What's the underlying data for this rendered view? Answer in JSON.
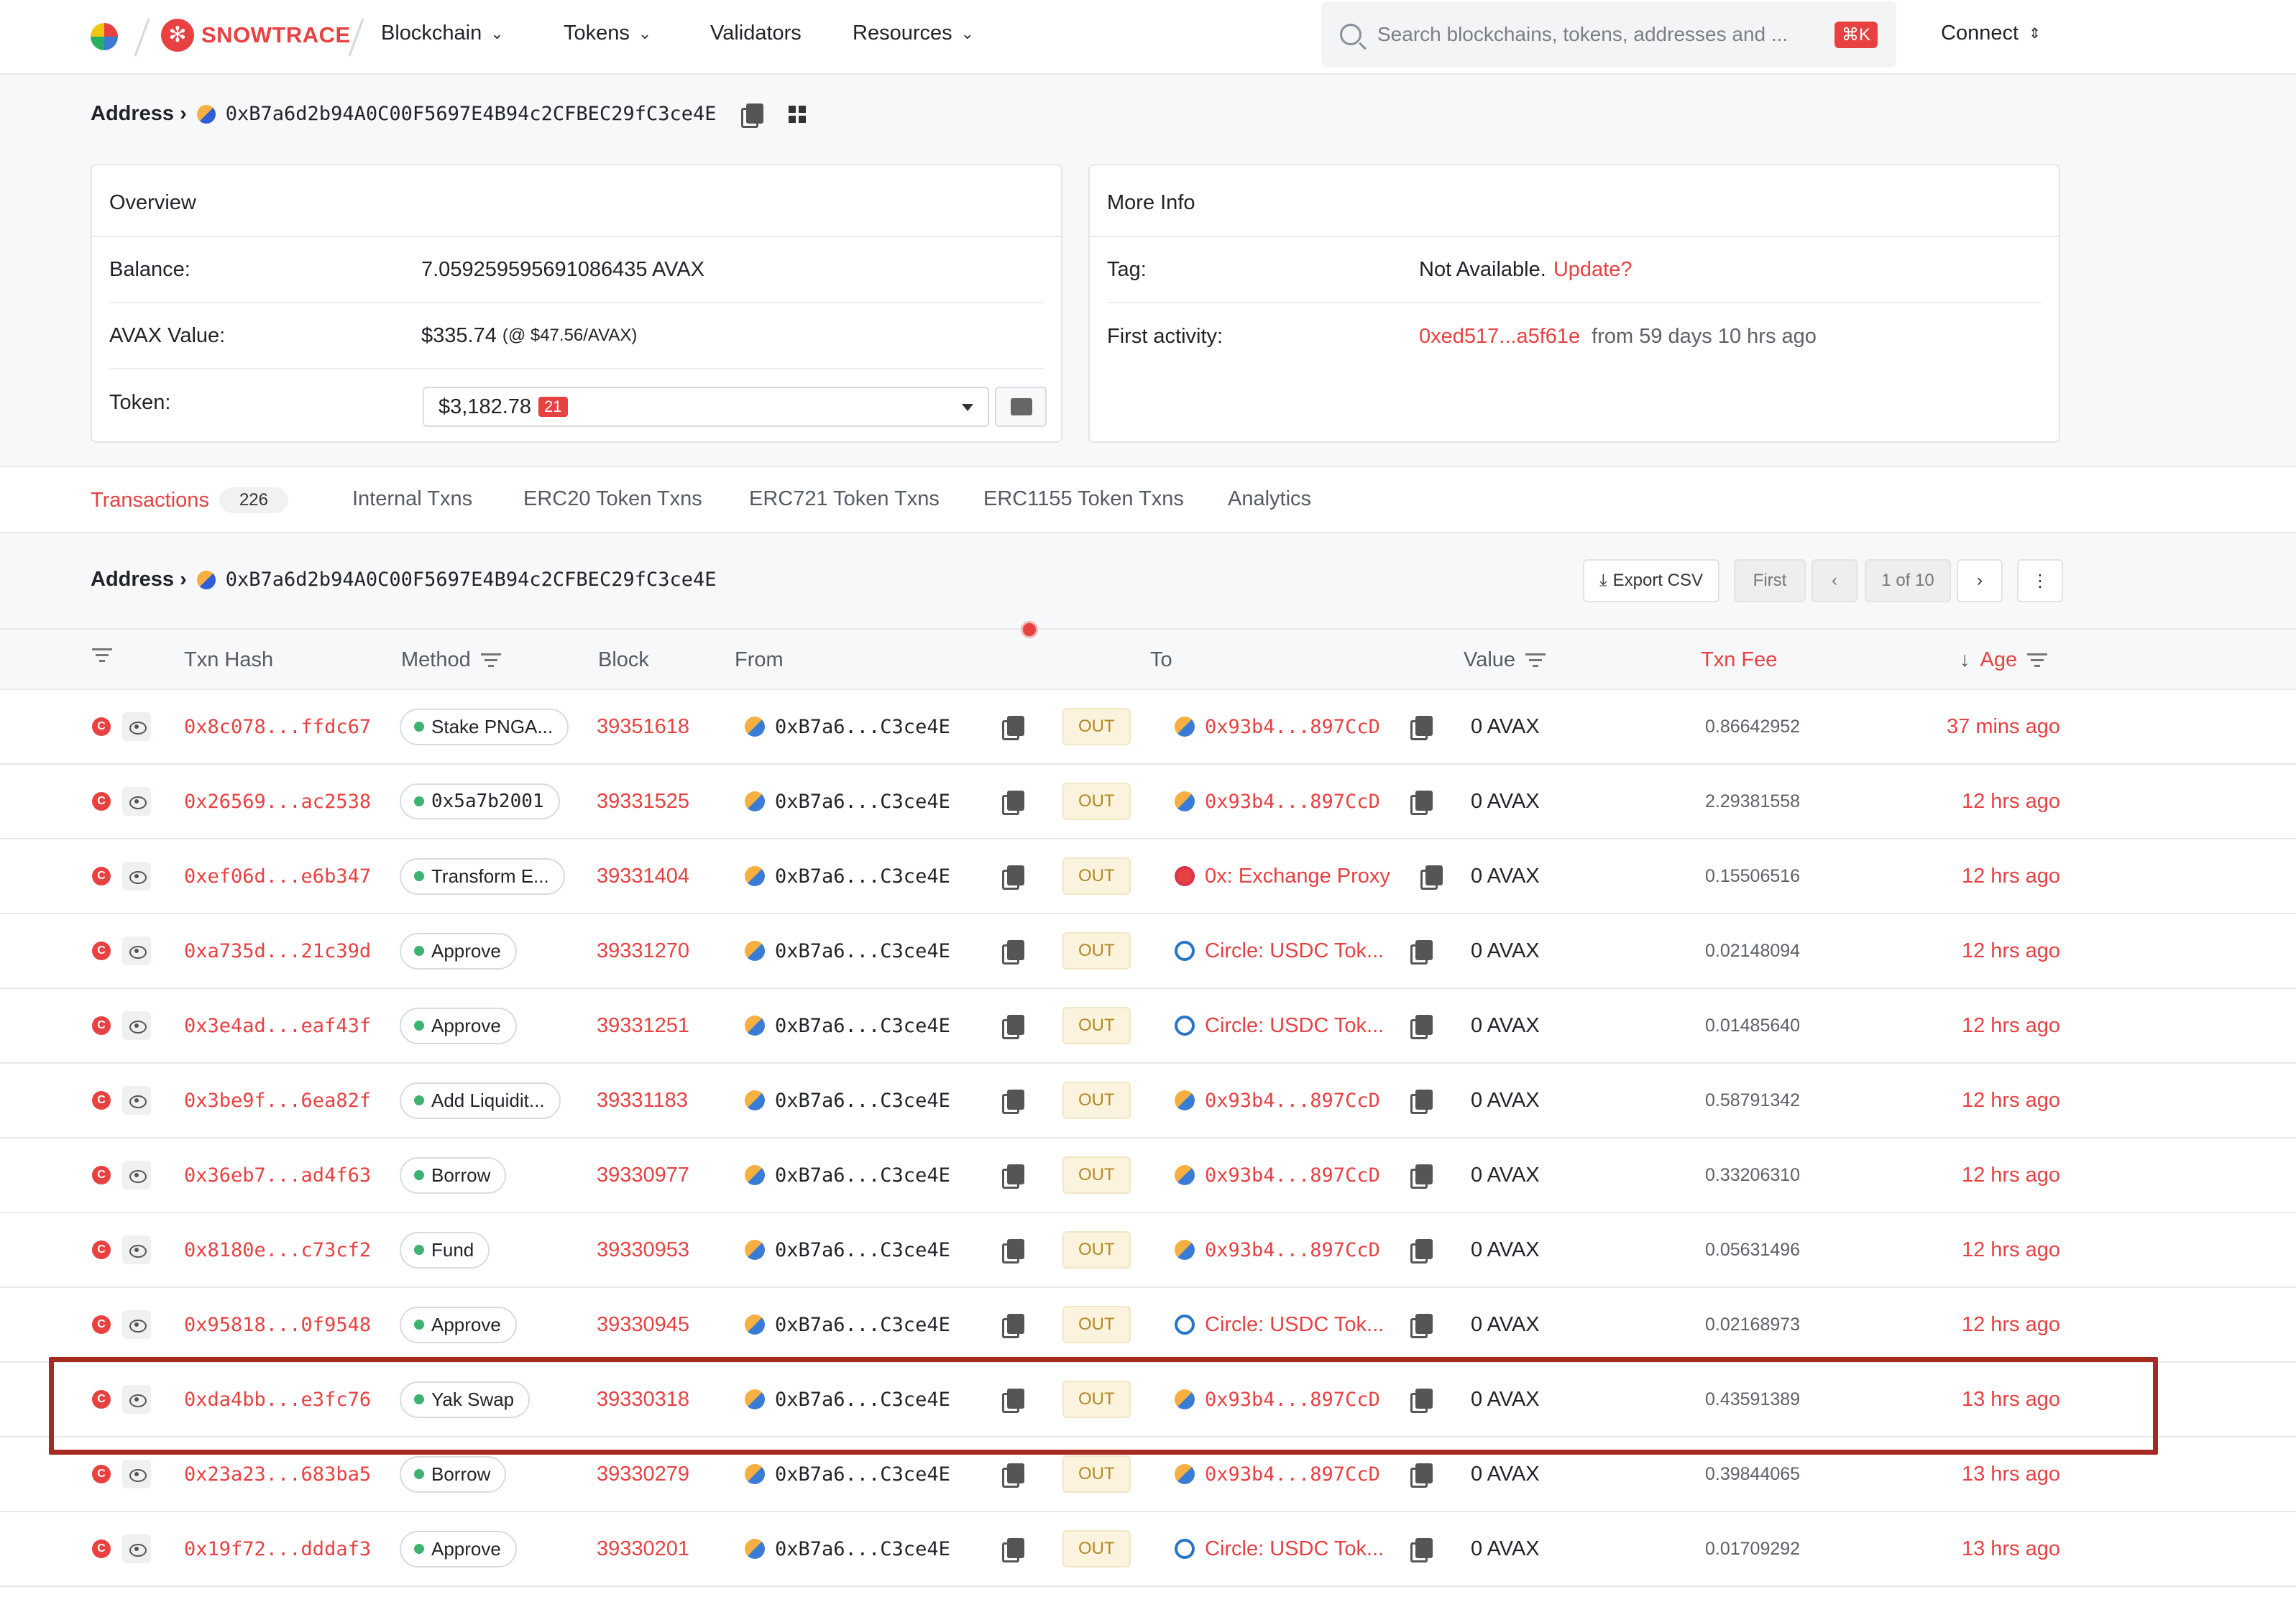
{
  "nav": {
    "brand": "SNOWTRACE",
    "items": [
      {
        "label": "Blockchain",
        "dropdown": true
      },
      {
        "label": "Tokens",
        "dropdown": true
      },
      {
        "label": "Validators",
        "dropdown": false
      },
      {
        "label": "Resources",
        "dropdown": true
      }
    ],
    "search_placeholder": "Search blockchains, tokens, addresses and ...",
    "search_shortcut": "⌘K",
    "connect_label": "Connect"
  },
  "address": {
    "crumb_label": "Address ›",
    "value": "0xB7a6d2b94A0C00F5697E4B94c2CFBEC29fC3ce4E"
  },
  "overview": {
    "title": "Overview",
    "balance_label": "Balance:",
    "balance_value": "7.059259595691086435 AVAX",
    "avax_value_label": "AVAX Value:",
    "avax_value": "$335.74",
    "avax_rate": "(@ $47.56/AVAX)",
    "token_label": "Token:",
    "token_value": "$3,182.78",
    "token_count": "21"
  },
  "more_info": {
    "title": "More Info",
    "tag_label": "Tag:",
    "tag_value": "Not Available.",
    "tag_update": "Update?",
    "first_activity_label": "First activity:",
    "first_activity_tx": "0xed517...a5f61e",
    "first_activity_age": "from 59 days 10 hrs ago"
  },
  "tabs": [
    {
      "label": "Transactions",
      "count": "226",
      "active": true
    },
    {
      "label": "Internal Txns"
    },
    {
      "label": "ERC20 Token Txns"
    },
    {
      "label": "ERC721 Token Txns"
    },
    {
      "label": "ERC1155 Token Txns"
    },
    {
      "label": "Analytics"
    }
  ],
  "table_toolbar": {
    "crumb_label": "Address ›",
    "address": "0xB7a6d2b94A0C00F5697E4B94c2CFBEC29fC3ce4E",
    "export_label": "Export CSV",
    "first_label": "First",
    "page_label": "1 of 10"
  },
  "columns": {
    "hash": "Txn Hash",
    "method": "Method",
    "block": "Block",
    "from": "From",
    "to": "To",
    "value": "Value",
    "fee": "Txn Fee",
    "age": "Age"
  },
  "rows": [
    {
      "hash": "0x8c078...ffdc67",
      "method": "Stake PNGA...",
      "method_mono": false,
      "block": "39351618",
      "from": "0xB7a6...C3ce4E",
      "dir": "OUT",
      "to": "0x93b4...897CcD",
      "to_type": "multi",
      "to_mono": true,
      "value": "0 AVAX",
      "fee": "0.86642952",
      "age": "37 mins ago"
    },
    {
      "hash": "0x26569...ac2538",
      "method": "0x5a7b2001",
      "method_mono": true,
      "block": "39331525",
      "from": "0xB7a6...C3ce4E",
      "dir": "OUT",
      "to": "0x93b4...897CcD",
      "to_type": "multi",
      "to_mono": true,
      "value": "0 AVAX",
      "fee": "2.29381558",
      "age": "12 hrs ago"
    },
    {
      "hash": "0xef06d...e6b347",
      "method": "Transform E...",
      "method_mono": false,
      "block": "39331404",
      "from": "0xB7a6...C3ce4E",
      "dir": "OUT",
      "to": "0x: Exchange Proxy",
      "to_type": "pink",
      "to_mono": false,
      "value": "0 AVAX",
      "fee": "0.15506516",
      "age": "12 hrs ago"
    },
    {
      "hash": "0xa735d...21c39d",
      "method": "Approve",
      "method_mono": false,
      "block": "39331270",
      "from": "0xB7a6...C3ce4E",
      "dir": "OUT",
      "to": "Circle: USDC Tok...",
      "to_type": "usdc",
      "to_mono": false,
      "value": "0 AVAX",
      "fee": "0.02148094",
      "age": "12 hrs ago"
    },
    {
      "hash": "0x3e4ad...eaf43f",
      "method": "Approve",
      "method_mono": false,
      "block": "39331251",
      "from": "0xB7a6...C3ce4E",
      "dir": "OUT",
      "to": "Circle: USDC Tok...",
      "to_type": "usdc",
      "to_mono": false,
      "value": "0 AVAX",
      "fee": "0.01485640",
      "age": "12 hrs ago"
    },
    {
      "hash": "0x3be9f...6ea82f",
      "method": "Add Liquidit...",
      "method_mono": false,
      "block": "39331183",
      "from": "0xB7a6...C3ce4E",
      "dir": "OUT",
      "to": "0x93b4...897CcD",
      "to_type": "multi",
      "to_mono": true,
      "value": "0 AVAX",
      "fee": "0.58791342",
      "age": "12 hrs ago"
    },
    {
      "hash": "0x36eb7...ad4f63",
      "method": "Borrow",
      "method_mono": false,
      "block": "39330977",
      "from": "0xB7a6...C3ce4E",
      "dir": "OUT",
      "to": "0x93b4...897CcD",
      "to_type": "multi",
      "to_mono": true,
      "value": "0 AVAX",
      "fee": "0.33206310",
      "age": "12 hrs ago"
    },
    {
      "hash": "0x8180e...c73cf2",
      "method": "Fund",
      "method_mono": false,
      "block": "39330953",
      "from": "0xB7a6...C3ce4E",
      "dir": "OUT",
      "to": "0x93b4...897CcD",
      "to_type": "multi",
      "to_mono": true,
      "value": "0 AVAX",
      "fee": "0.05631496",
      "age": "12 hrs ago"
    },
    {
      "hash": "0x95818...0f9548",
      "method": "Approve",
      "method_mono": false,
      "block": "39330945",
      "from": "0xB7a6...C3ce4E",
      "dir": "OUT",
      "to": "Circle: USDC Tok...",
      "to_type": "usdc",
      "to_mono": false,
      "value": "0 AVAX",
      "fee": "0.02168973",
      "age": "12 hrs ago"
    },
    {
      "hash": "0xda4bb...e3fc76",
      "method": "Yak Swap",
      "method_mono": false,
      "block": "39330318",
      "from": "0xB7a6...C3ce4E",
      "dir": "OUT",
      "to": "0x93b4...897CcD",
      "to_type": "multi",
      "to_mono": true,
      "value": "0 AVAX",
      "fee": "0.43591389",
      "age": "13 hrs ago"
    },
    {
      "hash": "0x23a23...683ba5",
      "method": "Borrow",
      "method_mono": false,
      "block": "39330279",
      "from": "0xB7a6...C3ce4E",
      "dir": "OUT",
      "to": "0x93b4...897CcD",
      "to_type": "multi",
      "to_mono": true,
      "value": "0 AVAX",
      "fee": "0.39844065",
      "age": "13 hrs ago"
    },
    {
      "hash": "0x19f72...dddaf3",
      "method": "Approve",
      "method_mono": false,
      "block": "39330201",
      "from": "0xB7a6...C3ce4E",
      "dir": "OUT",
      "to": "Circle: USDC Tok...",
      "to_type": "usdc",
      "to_mono": false,
      "value": "0 AVAX",
      "fee": "0.01709292",
      "age": "13 hrs ago"
    }
  ],
  "highlighted_row_hash": "0xda4bb...e3fc76",
  "colors": {
    "accent": "#e84142",
    "highlight_border": "#a52a20",
    "out_badge_bg": "#fbf3de"
  }
}
